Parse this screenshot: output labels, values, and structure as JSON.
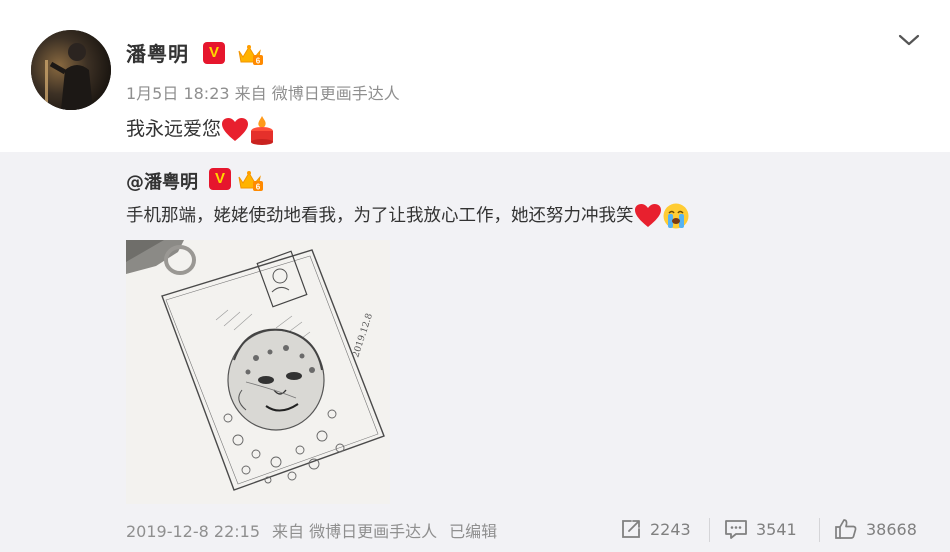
{
  "post": {
    "author": "潘粤明",
    "verified_badge": "V",
    "meta": "1月5日 18:23 来自 微博日更画手达人",
    "content": "我永远爱您"
  },
  "repost": {
    "author": "@潘粤明",
    "text": "手机那端，姥姥使劲地看我，为了让我放心工作，她还努力冲我笑",
    "image_date": "2019.12.8",
    "timestamp": "2019-12-8 22:15",
    "source": "来自 微博日更画手达人",
    "edited": "已编辑",
    "shares": "2243",
    "comments": "3541",
    "likes": "38668"
  },
  "colors": {
    "accent_red": "#e6162d",
    "meta_gray": "#8f8f8f",
    "repost_bg": "#f2f2f5"
  },
  "icons": [
    "chevron-down-icon",
    "verified-v-icon",
    "vip-crown-icon",
    "heart-emoji",
    "candle-emoji",
    "crying-emoji",
    "share-icon",
    "comment-icon",
    "like-icon"
  ]
}
